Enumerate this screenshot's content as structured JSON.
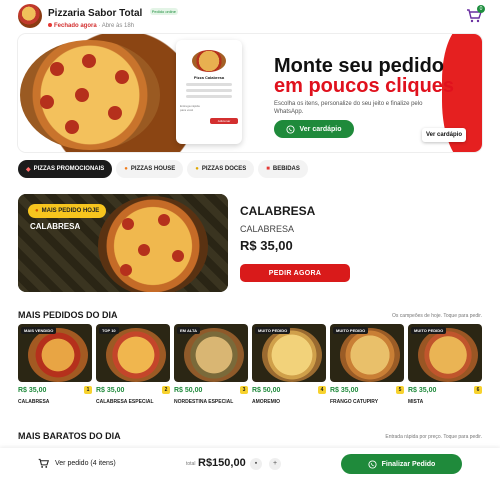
{
  "header": {
    "store_name": "Pizzaria Sabor Total",
    "badge": "Pedido online",
    "status": "Fechado agora",
    "opening": "· Abre às 18h",
    "cart_count": "0"
  },
  "hero": {
    "title_line1": "Monte seu pedido",
    "title_line2": "em poucos cliques",
    "subtitle": "Escolha os itens, personalize do seu jeito e finalize pelo WhatsApp.",
    "button": "Ver cardápio",
    "pill": "Ver cardápio",
    "phone_item": "Pizza Calabresa",
    "phone_button": "Adicionar",
    "phone_caption": "Entrega rápida para você"
  },
  "tabs": [
    {
      "label": "PIZZAS PROMOCIONAIS",
      "icon": "pizza-icon"
    },
    {
      "label": "PIZZAS HOUSE",
      "icon": "flame-icon"
    },
    {
      "label": "PIZZAS DOCES",
      "icon": "bell-icon"
    },
    {
      "label": "BEBIDAS",
      "icon": "cup-icon"
    }
  ],
  "featured": {
    "badge": "MAIS PEDIDO HOJE",
    "image_label": "CALABRESA",
    "title": "CALABRESA",
    "subtitle": "CALABRESA",
    "price": "R$ 35,00",
    "button": "PEDIR AGORA"
  },
  "most_ordered": {
    "title": "MAIS PEDIDOS DO DIA",
    "note": "Os campeões de hoje. Toque para pedir.",
    "cards": [
      {
        "tag": "MAIS VENDIDO",
        "price": "R$ 35,00",
        "num": "1",
        "name": "CALABRESA"
      },
      {
        "tag": "TOP 10",
        "price": "R$ 35,00",
        "num": "2",
        "name": "CALABRESA ESPECIAL"
      },
      {
        "tag": "EM ALTA",
        "price": "R$ 50,00",
        "num": "3",
        "name": "NORDESTINA ESPECIAL"
      },
      {
        "tag": "MUITO PEDIDO",
        "price": "R$ 50,00",
        "num": "4",
        "name": "AMOREMIO"
      },
      {
        "tag": "MUITO PEDIDO",
        "price": "R$ 35,00",
        "num": "5",
        "name": "FRANGO CATUPIRY"
      },
      {
        "tag": "MUITO PEDIDO",
        "price": "R$ 35,00",
        "num": "6",
        "name": "MISTA"
      }
    ]
  },
  "cheapest": {
    "title": "MAIS BARATOS DO DIA",
    "note": "Entrada rápida por preço. Toque para pedir."
  },
  "bottom_bar": {
    "cart_label": "Ver pedido (4 itens)",
    "total_label": "total",
    "total_value": "R$150,00",
    "finish_button": "Finalizar Pedido"
  },
  "colors": {
    "brand_red": "#e0111d",
    "whatsapp_green": "#1f8a3b",
    "tag_yellow": "#f7c51e"
  }
}
